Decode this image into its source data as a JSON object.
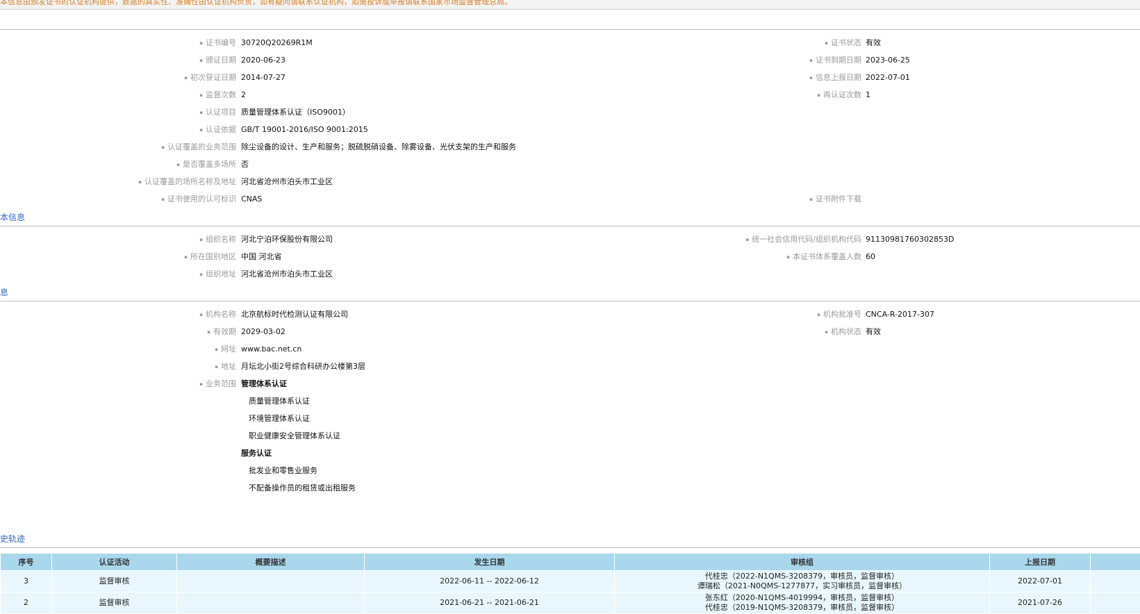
{
  "notice": "本信息由颁发证书的认证机构提供，数据的真实性、准确性由认证机构负责，如有疑问请联系认证机构，如需投诉或举报请联系国家市场监督管理总局。",
  "certificate": {
    "left": [
      {
        "label": "证书编号",
        "value": "30720Q20269R1M"
      },
      {
        "label": "颁证日期",
        "value": "2020-06-23"
      },
      {
        "label": "初次获证日期",
        "value": "2014-07-27"
      },
      {
        "label": "监督次数",
        "value": "2"
      },
      {
        "label": "认证项目",
        "value": "质量管理体系认证（ISO9001）"
      },
      {
        "label": "认证依据",
        "value": "GB/T 19001-2016/ISO 9001:2015"
      },
      {
        "label": "认证覆盖的业务范围",
        "value": "除尘设备的设计、生产和服务；脱硫脱硝设备、除雾设备、光伏支架的生产和服务"
      },
      {
        "label": "是否覆盖多场所",
        "value": "否"
      },
      {
        "label": "认证覆盖的场所名称及地址",
        "value": "河北省沧州市泊头市工业区"
      },
      {
        "label": "证书使用的认可标识",
        "value": "CNAS"
      }
    ],
    "right": [
      {
        "label": "证书状态",
        "value": "有效"
      },
      {
        "label": "证书到期日期",
        "value": "2023-06-25"
      },
      {
        "label": "信息上报日期",
        "value": "2022-07-01"
      },
      {
        "label": "再认证次数",
        "value": "1"
      },
      {
        "label": "证书附件下载",
        "value": ""
      }
    ]
  },
  "org_section_title": "本信息",
  "organization": {
    "left": [
      {
        "label": "组织名称",
        "value": "河北宁泊环保股份有限公司"
      },
      {
        "label": "所在国别地区",
        "value": "中国 河北省"
      },
      {
        "label": "组织地址",
        "value": "河北省沧州市泊头市工业区"
      }
    ],
    "right": [
      {
        "label": "统一社会信用代码/组织机构代码",
        "value": "91130981760302853D"
      },
      {
        "label": "本证书体系覆盖人数",
        "value": "60"
      }
    ]
  },
  "body_section_title": "息",
  "cert_body": {
    "left": [
      {
        "label": "机构名称",
        "value": "北京航标时代检测认证有限公司"
      },
      {
        "label": "有效期",
        "value": "2029-03-02"
      },
      {
        "label": "网址",
        "value": "www.bac.net.cn"
      },
      {
        "label": "地址",
        "value": "月坛北小街2号综合科研办公楼第3层"
      },
      {
        "label": "业务范围",
        "value": ""
      }
    ],
    "right": [
      {
        "label": "机构批准号",
        "value": "CNCA-R-2017-307"
      },
      {
        "label": "机构状态",
        "value": "有效"
      }
    ],
    "scope": {
      "group1": "管理体系认证",
      "group1_items": [
        "质量管理体系认证",
        "环境管理体系认证",
        "职业健康安全管理体系认证"
      ],
      "group2": "服务认证",
      "group2_items": [
        "批发业和零售业服务",
        "不配备操作员的租赁或出租服务"
      ]
    }
  },
  "history_section_title": "史轨迹",
  "history": {
    "headers": [
      "序号",
      "认证活动",
      "概要描述",
      "发生日期",
      "审核组",
      "上报日期",
      ""
    ],
    "rows": [
      {
        "no": "3",
        "activity": "监督审核",
        "summary": "",
        "date": "2022-06-11 -- 2022-06-12",
        "team1": "代桂忠（2022-N1QMS-3208379，审核员，监督审核）",
        "team2": "谭瑞松（2021-N0QMS-1277877，实习审核员，监督审核）",
        "reported": "2022-07-01"
      },
      {
        "no": "2",
        "activity": "监督审核",
        "summary": "",
        "date": "2021-06-21 -- 2021-06-21",
        "team1": "张东红（2020-N1QMS-4019994，审核员，监督审核）",
        "team2": "代桂忠（2019-N1QMS-3208379，审核员，监督审核）",
        "reported": "2021-07-26"
      }
    ]
  }
}
